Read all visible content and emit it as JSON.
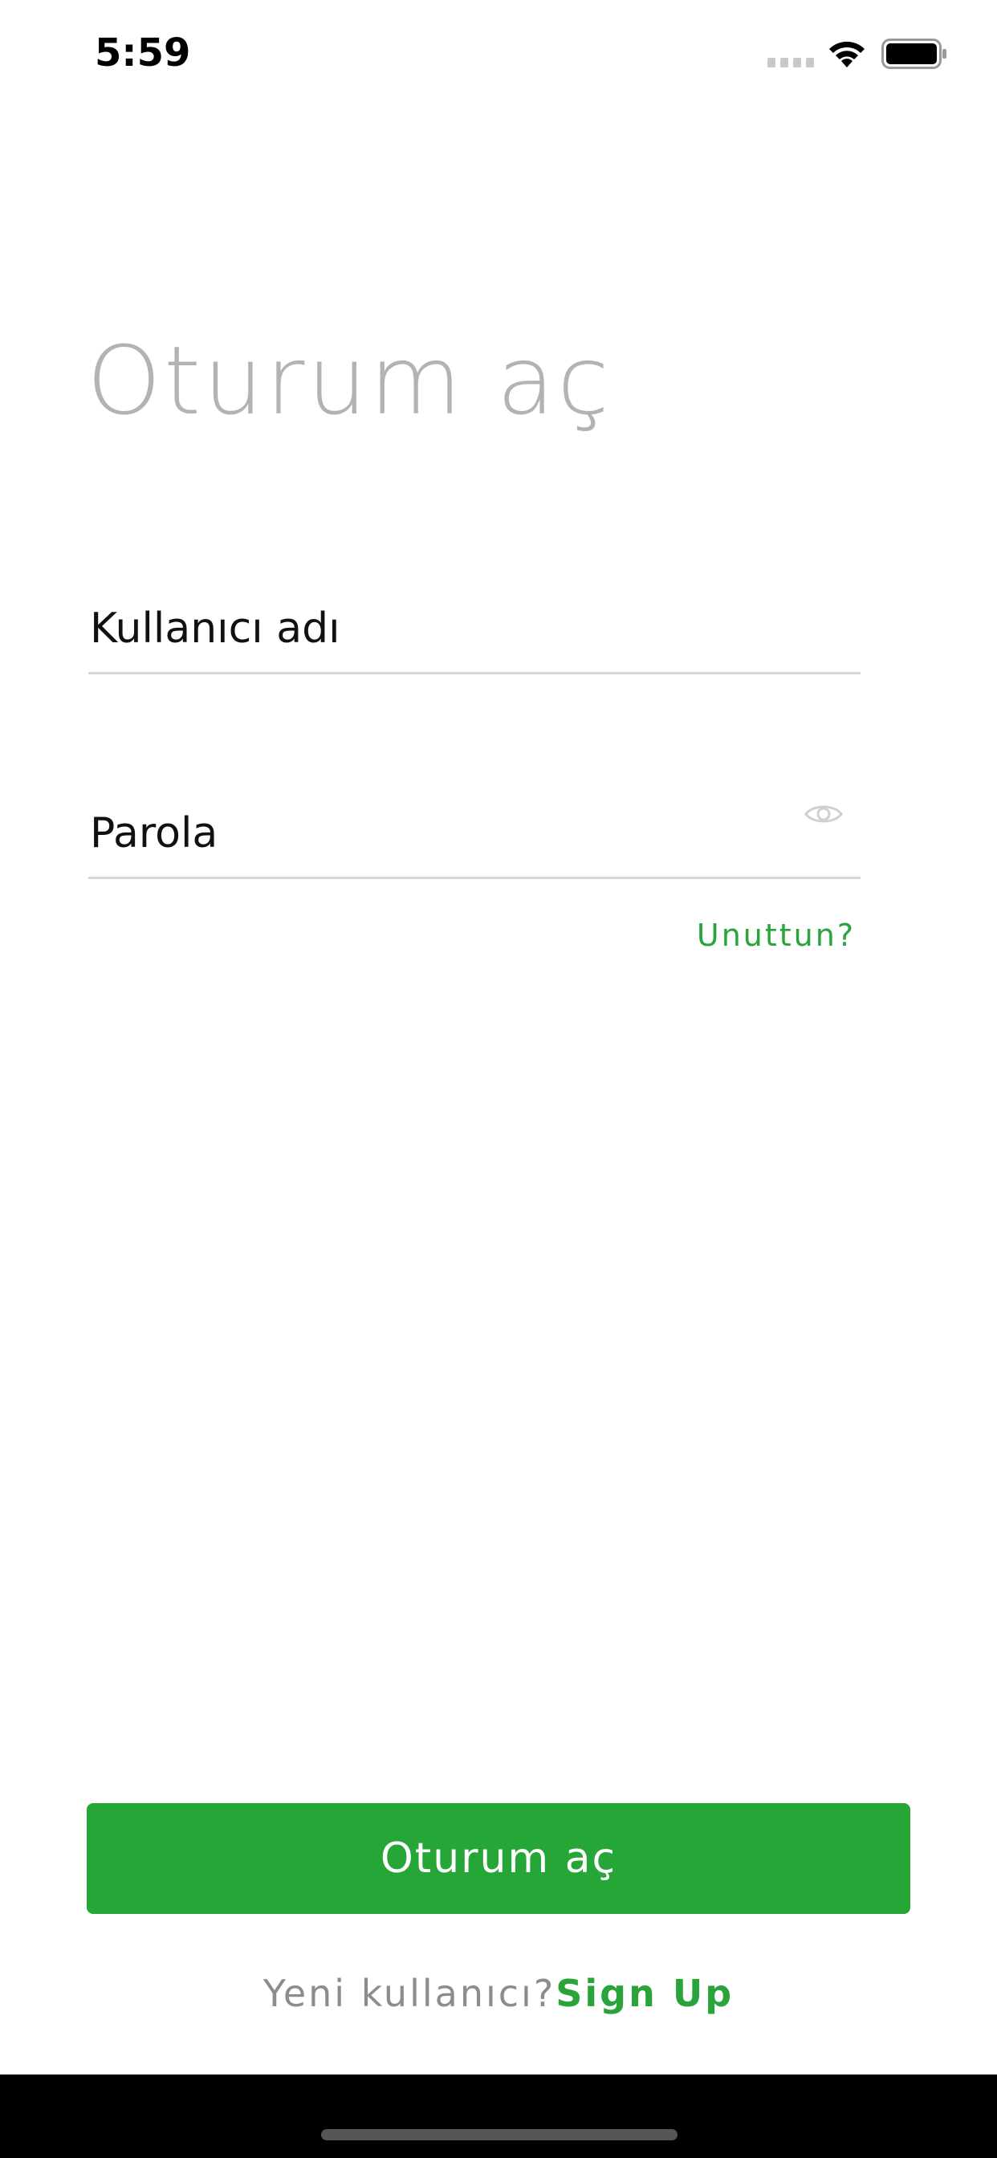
{
  "status_bar": {
    "time": "5:59"
  },
  "login": {
    "title": "Oturum aç",
    "username_placeholder": "Kullanıcı adı",
    "password_placeholder": "Parola",
    "forgot_label": "Unuttun?",
    "submit_label": "Oturum aç",
    "signup_prompt": "Yeni kullanıcı?",
    "signup_label": "Sign Up"
  },
  "icons": {
    "signal": "signal-icon",
    "wifi": "wifi-icon",
    "battery": "battery-icon",
    "eye": "eye-icon"
  },
  "colors": {
    "accent": "#27a638",
    "title": "#b3b3b3",
    "muted_text": "#8c8c8c",
    "divider": "#d6d6d6"
  }
}
